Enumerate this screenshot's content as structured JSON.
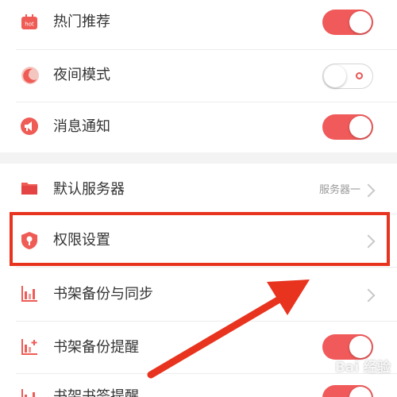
{
  "settings": {
    "hot": {
      "label": "热门推荐",
      "icon": "hot-icon",
      "badge": "hot",
      "state": "on"
    },
    "night": {
      "label": "夜间模式",
      "icon": "moon-icon",
      "state": "off"
    },
    "notify": {
      "label": "消息通知",
      "icon": "megaphone-icon",
      "state": "on"
    },
    "server": {
      "label": "默认服务器",
      "icon": "folder-icon",
      "value": "服务器一"
    },
    "permission": {
      "label": "权限设置",
      "icon": "shield-key-icon"
    },
    "backup_sync": {
      "label": "书架备份与同步",
      "icon": "bar-chart-icon"
    },
    "backup_remind": {
      "label": "书架备份提醒",
      "icon": "bar-chart-plus-icon",
      "state": "on"
    },
    "bookmark_remind": {
      "label": "书架书签提醒",
      "icon": "bar-chart-icon",
      "state": "on"
    }
  },
  "watermark": "Bai 经验",
  "colors": {
    "accent": "#f05a5a",
    "highlight_box": "#e8331f",
    "arrow": "#e8331f"
  }
}
